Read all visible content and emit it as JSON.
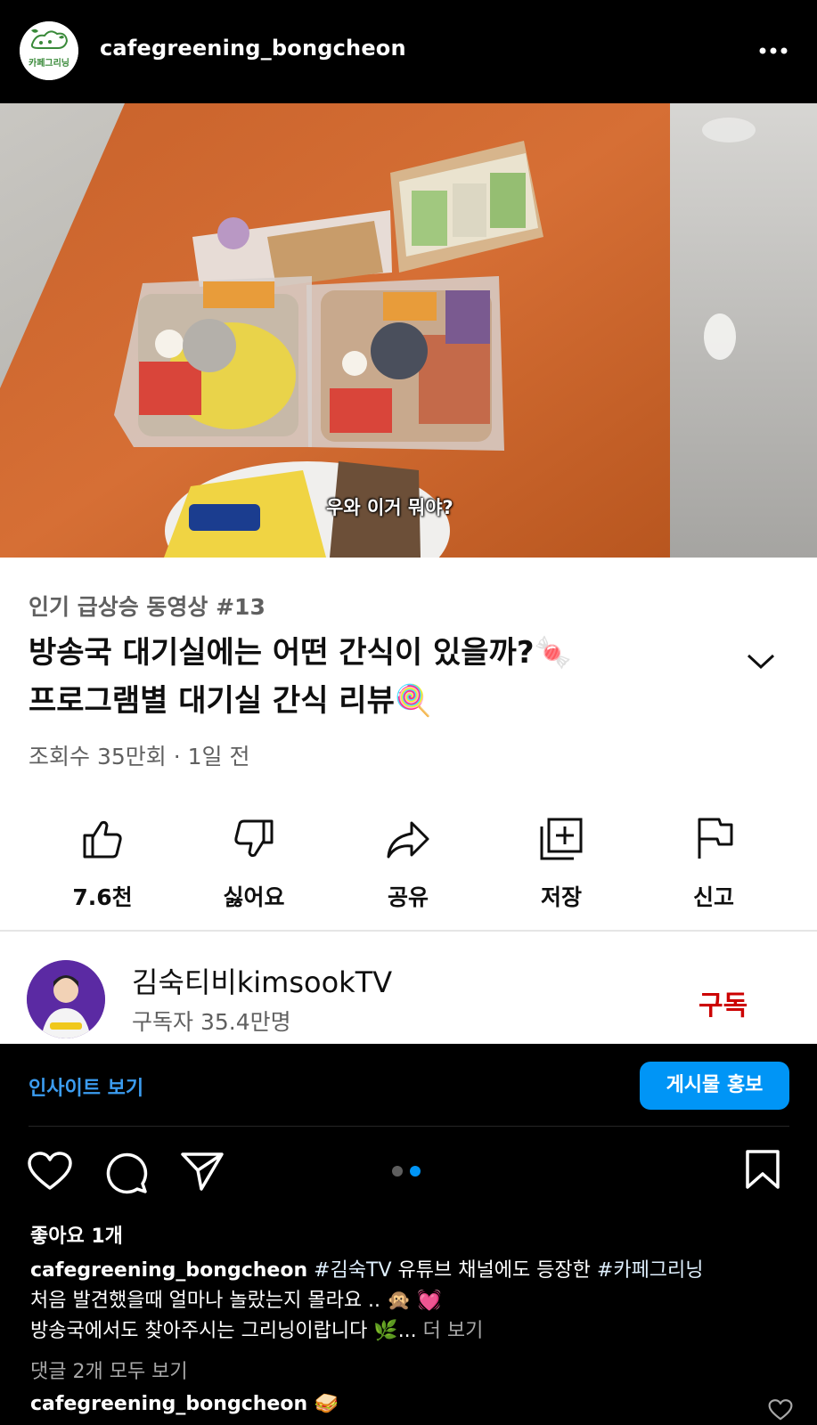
{
  "post": {
    "username": "cafegreening_bongcheon",
    "logo_text": "카페그리닝",
    "more_icon": "more-horizontal-icon"
  },
  "video": {
    "subtitle": "우와 이거 뭐야?",
    "trending_label": "인기 급상승 동영상 #13",
    "title_line1": "방송국 대기실에는 어떤 간식이 있을까?🍬",
    "title_line2": "프로그램별 대기실 간식 리뷰🍭",
    "meta": "조회수 35만회 · 1일 전",
    "actions": [
      {
        "icon": "thumbs-up-icon",
        "label": "7.6천"
      },
      {
        "icon": "thumbs-down-icon",
        "label": "싫어요"
      },
      {
        "icon": "share-icon",
        "label": "공유"
      },
      {
        "icon": "save-playlist-icon",
        "label": "저장"
      },
      {
        "icon": "flag-icon",
        "label": "신고"
      }
    ],
    "channel_name": "김숙티비kimsookTV",
    "channel_subs": "구독자 35.4만명",
    "subscribe_label": "구독"
  },
  "insights": {
    "view_insights": "인사이트 보기",
    "promote": "게시물 홍보"
  },
  "carousel": {
    "total": 2,
    "active": 2,
    "active_color": "#0095f6",
    "inactive_color": "#5e5e5e"
  },
  "engagement": {
    "likes": "좋아요 1개",
    "caption_user": "cafegreening_bongcheon",
    "caption_line1_tag1": "#김숙TV",
    "caption_line1_text": " 유튜브 채널에도 등장한 ",
    "caption_line1_tag2": "#카페그리닝",
    "caption_line2": "처음 발견했을때 얼마나 놀랐는지 몰라요 .. 🙊 💓",
    "caption_line3": "방송국에서도 찾아주시는 그리닝이랍니다 🌿...",
    "more": " 더 보기",
    "view_comments": "댓글 2개 모두 보기",
    "comment_user": "cafegreening_bongcheon",
    "comment_emoji": "🥪"
  }
}
